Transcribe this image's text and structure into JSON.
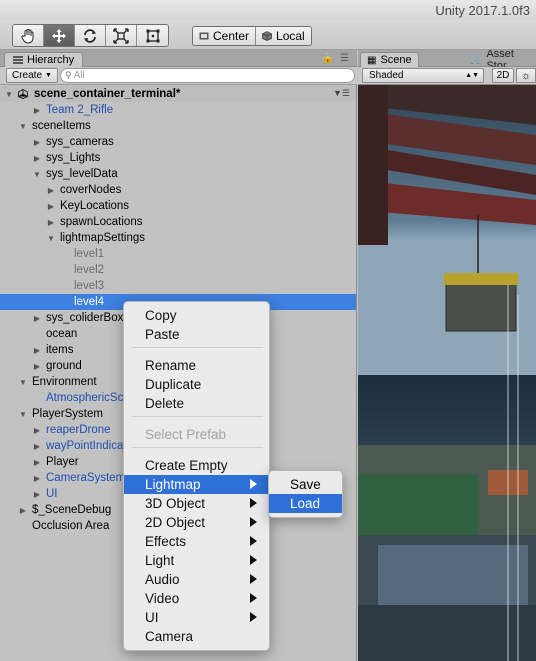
{
  "window": {
    "title": "Unity 2017.1.0f3"
  },
  "toolbar": {
    "tools": [
      "hand-tool",
      "move-tool",
      "rotate-tool",
      "scale-tool",
      "rect-tool"
    ],
    "pivot": {
      "center_label": "Center",
      "local_label": "Local"
    }
  },
  "hierarchy": {
    "tab_label": "Hierarchy",
    "create_label": "Create",
    "search_placeholder": "All",
    "scene_name": "scene_container_terminal*",
    "rows": [
      {
        "label": "Team 2_Rifle",
        "color": "blue",
        "arrow": "collapsed"
      },
      {
        "label": "sceneItems",
        "color": "normal",
        "arrow": "expanded"
      },
      {
        "label": "sys_cameras",
        "color": "normal",
        "arrow": "collapsed"
      },
      {
        "label": "sys_Lights",
        "color": "normal",
        "arrow": "collapsed"
      },
      {
        "label": "sys_levelData",
        "color": "normal",
        "arrow": "expanded"
      },
      {
        "label": "coverNodes",
        "color": "normal",
        "arrow": "collapsed"
      },
      {
        "label": "KeyLocations",
        "color": "normal",
        "arrow": "collapsed"
      },
      {
        "label": "spawnLocations",
        "color": "normal",
        "arrow": "collapsed"
      },
      {
        "label": "lightmapSettings",
        "color": "normal",
        "arrow": "expanded"
      },
      {
        "label": "level1",
        "color": "grey",
        "arrow": "none"
      },
      {
        "label": "level2",
        "color": "grey",
        "arrow": "none"
      },
      {
        "label": "level3",
        "color": "grey",
        "arrow": "none"
      },
      {
        "label": "level4",
        "color": "selected",
        "arrow": "none"
      },
      {
        "label": "sys_coliderBox",
        "color": "normal",
        "arrow": "collapsed"
      },
      {
        "label": "ocean",
        "color": "normal",
        "arrow": "none"
      },
      {
        "label": "items",
        "color": "normal",
        "arrow": "collapsed"
      },
      {
        "label": "ground",
        "color": "normal",
        "arrow": "collapsed"
      },
      {
        "label": "Environment",
        "color": "normal",
        "arrow": "expanded"
      },
      {
        "label": "AtmosphericSc",
        "color": "blue",
        "arrow": "none"
      },
      {
        "label": "PlayerSystem",
        "color": "normal",
        "arrow": "expanded"
      },
      {
        "label": "reaperDrone",
        "color": "blue",
        "arrow": "collapsed"
      },
      {
        "label": "wayPointIndica",
        "color": "blue",
        "arrow": "collapsed"
      },
      {
        "label": "Player",
        "color": "normal",
        "arrow": "collapsed"
      },
      {
        "label": "CameraSystem",
        "color": "blue",
        "arrow": "collapsed"
      },
      {
        "label": "UI",
        "color": "blue",
        "arrow": "collapsed"
      },
      {
        "label": "$_SceneDebug",
        "color": "normal",
        "arrow": "collapsed"
      },
      {
        "label": "Occlusion Area",
        "color": "normal",
        "arrow": "none"
      }
    ]
  },
  "scene_view": {
    "tab_label": "Scene",
    "asset_tab_label": "Asset Stor",
    "shading_mode": "Shaded",
    "mode_2d_label": "2D"
  },
  "context_menu": {
    "items": [
      "Copy",
      "Paste",
      "Rename",
      "Duplicate",
      "Delete",
      "Select Prefab",
      "Create Empty",
      "Lightmap",
      "3D Object",
      "2D Object",
      "Effects",
      "Light",
      "Audio",
      "Video",
      "UI",
      "Camera"
    ],
    "highlighted": "Lightmap",
    "disabled": [
      "Select Prefab"
    ]
  },
  "lightmap_submenu": {
    "items": [
      "Save",
      "Load"
    ],
    "highlighted": "Load"
  },
  "colors": {
    "selection": "#3d80df",
    "menu_highlight": "#2f6fd8",
    "prefab_blue": "#1f4fb0"
  }
}
